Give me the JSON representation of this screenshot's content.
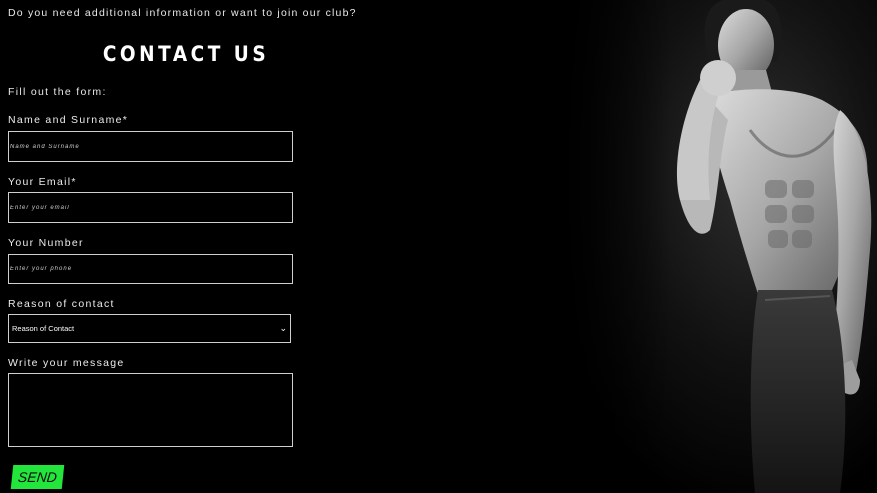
{
  "intro_text": "Do you need additional information or want to join our club?",
  "title": "CONTACT US",
  "subtitle": "Fill out the form:",
  "form": {
    "name": {
      "label": "Name and Surname*",
      "placeholder": "Name and Surname"
    },
    "email": {
      "label": "Your Email*",
      "placeholder": "Enter your email"
    },
    "phone": {
      "label": "Your Number",
      "placeholder": "Enter your phone"
    },
    "reason": {
      "label": "Reason of contact",
      "selected": "Reason of Contact",
      "icon": "chevron-down-icon"
    },
    "message": {
      "label": "Write your message",
      "value": ""
    },
    "submit_label": "SEND"
  },
  "colors": {
    "background": "#000000",
    "accent": "#22e63c",
    "text": "#ffffff",
    "field_border": "#cfcfcf"
  }
}
